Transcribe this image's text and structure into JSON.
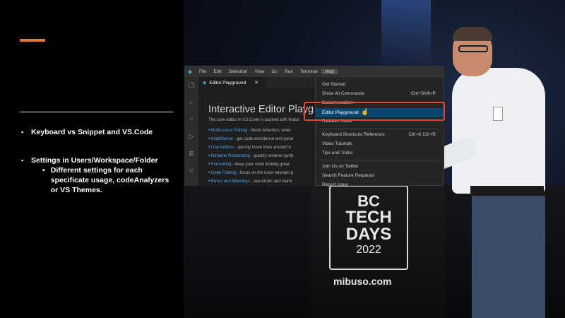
{
  "slide": {
    "bullets": [
      {
        "text": "Keyboard vs Snippet and VS.Code"
      },
      {
        "text": "Settings in Users/Workspace/Folder",
        "sub": [
          {
            "text": "Different settings for each specificate usage, codeAnalyzers or VS Themes."
          }
        ]
      }
    ],
    "accent_color": "#e8733a"
  },
  "vscode": {
    "menu": [
      "File",
      "Edit",
      "Selection",
      "View",
      "Go",
      "Run",
      "Terminal",
      "Help"
    ],
    "tab": {
      "label": "Editor Playground",
      "close": "✕"
    },
    "editor": {
      "title": "Interactive Editor Playg",
      "intro": "The core editor in VS Code is packed with featur",
      "features": [
        {
          "name": "Multi-cursor Editing",
          "desc": " - block selection, selec"
        },
        {
          "name": "IntelliSense",
          "desc": " - get code assistance and parar"
        },
        {
          "name": "Line Actions",
          "desc": " - quickly move lines around to"
        },
        {
          "name": "Rename Refactoring",
          "desc": " - quickly rename symb"
        },
        {
          "name": "Formatting",
          "desc": " - keep your code looking great"
        },
        {
          "name": "Code Folding",
          "desc": " - focus on the most relevant p"
        },
        {
          "name": "Errors and Warnings",
          "desc": " - see errors and warni"
        }
      ]
    },
    "help_menu": {
      "items": [
        {
          "label": "Get Started",
          "shortcut": ""
        },
        {
          "label": "Show All Commands",
          "shortcut": "Ctrl+Shift+P"
        },
        {
          "label": "Documentation",
          "shortcut": ""
        },
        {
          "label": "Editor Playground",
          "shortcut": "",
          "selected": true
        },
        {
          "label": "Release Notes",
          "shortcut": ""
        },
        {
          "label": "Keyboard Shortcuts Reference",
          "shortcut": "Ctrl+K Ctrl+R"
        },
        {
          "label": "Video Tutorials",
          "shortcut": ""
        },
        {
          "label": "Tips and Tricks",
          "shortcut": ""
        },
        {
          "label": "Join Us on Twitter",
          "shortcut": ""
        },
        {
          "label": "Search Feature Requests",
          "shortcut": ""
        },
        {
          "label": "Report Issue",
          "shortcut": ""
        }
      ]
    },
    "highlight_color": "#e0453c"
  },
  "photo": {
    "podium_logo": [
      "BC",
      "TECH",
      "DAYS",
      "2022"
    ],
    "podium_url": "mibuso.com"
  }
}
